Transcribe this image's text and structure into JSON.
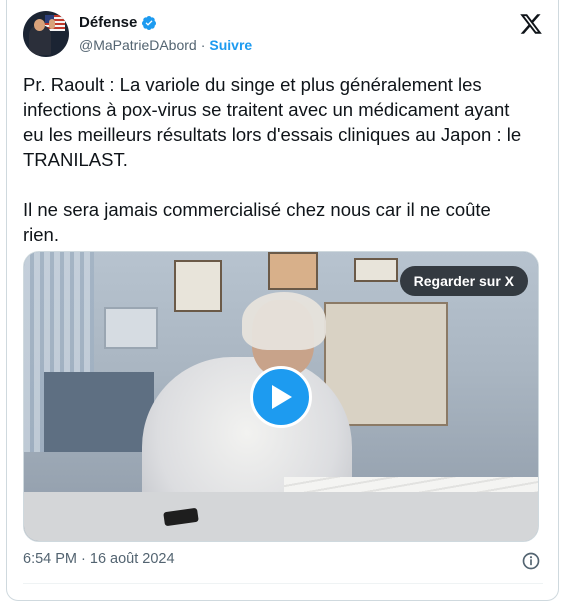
{
  "author": {
    "name": "Défense",
    "handle": "@MaPatrieDAbord",
    "separator": "·",
    "follow_label": "Suivre",
    "verified": true
  },
  "icons": {
    "verified": "verified-badge-icon",
    "x_logo": "x-logo-icon",
    "play": "play-icon",
    "info": "info-icon"
  },
  "tweet": {
    "paragraph_1": "Pr. Raoult : La variole du singe et plus généralement les infections à pox-virus se traitent avec un médicament ayant eu les meilleurs résultats lors d'essais cliniques au Japon : le TRANILAST.",
    "paragraph_2": "Il ne sera jamais commercialisé chez nous car il ne coûte rien."
  },
  "media": {
    "watch_label": "Regarder sur X"
  },
  "footer": {
    "timestamp": "6:54 PM · 16 août 2024"
  },
  "colors": {
    "accent": "#1d9bf0",
    "text": "#0f1419",
    "secondary": "#536471",
    "border": "#cfd9de"
  }
}
